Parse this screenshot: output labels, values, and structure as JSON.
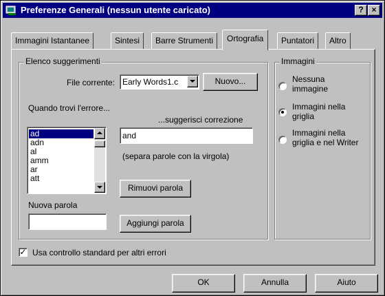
{
  "window": {
    "title": "Preferenze Generali  (nessun utente caricato)",
    "help_button": "?",
    "close_button": "×"
  },
  "tabs": [
    {
      "label": "Immagini Istantanee",
      "active": false
    },
    {
      "label": "Sintesi",
      "active": false
    },
    {
      "label": "Barre Strumenti",
      "active": false
    },
    {
      "label": "Ortografia",
      "active": true
    },
    {
      "label": "Puntatori",
      "active": false
    },
    {
      "label": "Altro",
      "active": false
    }
  ],
  "suggestions_group": {
    "legend": "Elenco suggerimenti",
    "current_file_label": "File corrente:",
    "current_file_value": "Early Words1.c",
    "new_button": "Nuovo...",
    "error_prompt": "Quando trovi l'errore...",
    "suggest_label": "...suggerisci correzione",
    "word_list": [
      "ad",
      "adn",
      "al",
      "amm",
      "ar",
      "att"
    ],
    "selected_word": "ad",
    "correction_value": "and",
    "separator_hint": "(separa parole con la virgola)",
    "remove_button": "Rimuovi parola",
    "new_word_label": "Nuova parola",
    "new_word_value": "",
    "add_button": "Aggiungi parola"
  },
  "images_group": {
    "legend": "Immagini",
    "options": [
      {
        "label_line1": "Nessuna",
        "label_line2": "immagine",
        "checked": false
      },
      {
        "label_line1": "Immagini nella",
        "label_line2": "griglia",
        "checked": true
      },
      {
        "label_line1": "Immagini nella",
        "label_line2": "griglia e nel Writer",
        "checked": false
      }
    ]
  },
  "standard_check": {
    "label": "Usa controllo standard per altri errori",
    "checked": true,
    "mark": "✓"
  },
  "footer": {
    "ok_button": "OK",
    "cancel_button": "Annulla",
    "help_button": "Aiuto"
  },
  "colors": {
    "titlebar": "#000080",
    "face": "#c0c0c0",
    "selection": "#000080"
  }
}
